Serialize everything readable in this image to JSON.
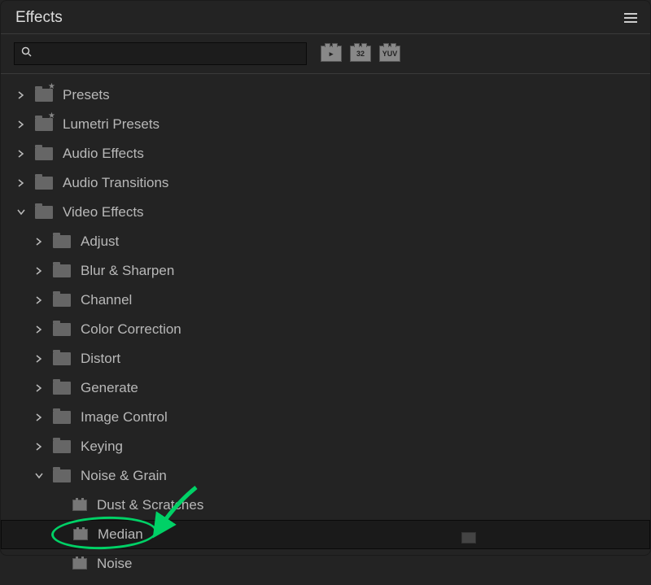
{
  "header": {
    "title": "Effects"
  },
  "search": {
    "placeholder": ""
  },
  "toolbar": {
    "icons": {
      "accelerated": "▸",
      "bit32": "32",
      "yuv": "YUV"
    }
  },
  "tree": {
    "presets": {
      "label": "Presets"
    },
    "lumetri_presets": {
      "label": "Lumetri Presets"
    },
    "audio_effects": {
      "label": "Audio Effects"
    },
    "audio_transitions": {
      "label": "Audio Transitions"
    },
    "video_effects": {
      "label": "Video Effects",
      "children": {
        "adjust": {
          "label": "Adjust"
        },
        "blur_sharpen": {
          "label": "Blur & Sharpen"
        },
        "channel": {
          "label": "Channel"
        },
        "color_correction": {
          "label": "Color Correction"
        },
        "distort": {
          "label": "Distort"
        },
        "generate": {
          "label": "Generate"
        },
        "image_control": {
          "label": "Image Control"
        },
        "keying": {
          "label": "Keying"
        },
        "noise_grain": {
          "label": "Noise & Grain",
          "children": {
            "dust_scratches": {
              "label": "Dust & Scratches"
            },
            "median": {
              "label": "Median"
            },
            "noise": {
              "label": "Noise"
            }
          }
        }
      }
    }
  }
}
